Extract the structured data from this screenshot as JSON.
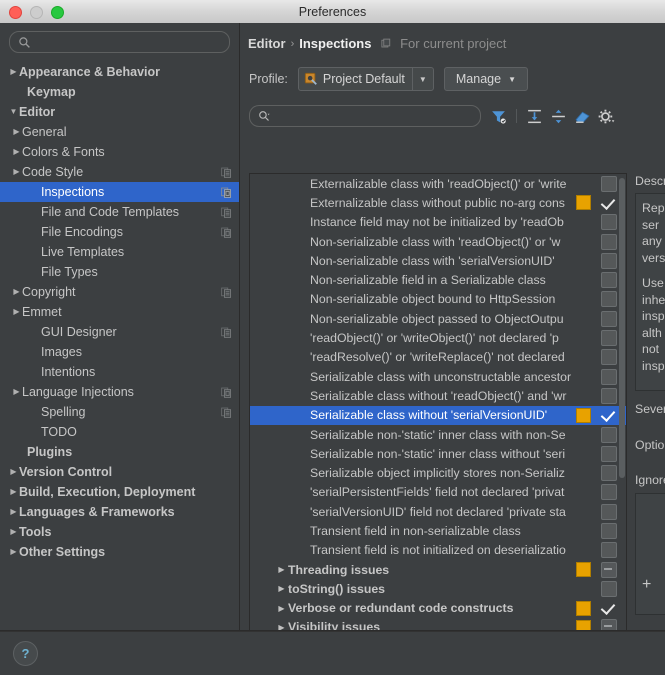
{
  "window": {
    "title": "Preferences",
    "traffic_lights": [
      "close-red",
      "minimize-disabled",
      "zoom-green"
    ]
  },
  "sidebar": {
    "search": {
      "value": "",
      "placeholder": ""
    },
    "items": [
      {
        "label": "Appearance & Behavior",
        "level": 0,
        "arrow": "▶",
        "bold": true,
        "icon": ""
      },
      {
        "label": "Keymap",
        "level": 0,
        "arrow": "",
        "bold": true,
        "icon": ""
      },
      {
        "label": "Editor",
        "level": 0,
        "arrow": "▼",
        "bold": true,
        "icon": ""
      },
      {
        "label": "General",
        "level": 1,
        "arrow": "▶",
        "bold": false,
        "icon": ""
      },
      {
        "label": "Colors & Fonts",
        "level": 1,
        "arrow": "▶",
        "bold": false,
        "icon": ""
      },
      {
        "label": "Code Style",
        "level": 1,
        "arrow": "▶",
        "bold": false,
        "icon": "copy-scope-icon"
      },
      {
        "label": "Inspections",
        "level": 1,
        "arrow": "",
        "bold": false,
        "icon": "project-scope-icon",
        "selected": true
      },
      {
        "label": "File and Code Templates",
        "level": 1,
        "arrow": "",
        "bold": false,
        "icon": "copy-scope-icon"
      },
      {
        "label": "File Encodings",
        "level": 1,
        "arrow": "",
        "bold": false,
        "icon": "project-scope-icon"
      },
      {
        "label": "Live Templates",
        "level": 1,
        "arrow": "",
        "bold": false,
        "icon": ""
      },
      {
        "label": "File Types",
        "level": 1,
        "arrow": "",
        "bold": false,
        "icon": ""
      },
      {
        "label": "Copyright",
        "level": 1,
        "arrow": "▶",
        "bold": false,
        "icon": "copy-scope-icon"
      },
      {
        "label": "Emmet",
        "level": 1,
        "arrow": "▶",
        "bold": false,
        "icon": ""
      },
      {
        "label": "GUI Designer",
        "level": 1,
        "arrow": "",
        "bold": false,
        "icon": "copy-scope-icon"
      },
      {
        "label": "Images",
        "level": 1,
        "arrow": "",
        "bold": false,
        "icon": ""
      },
      {
        "label": "Intentions",
        "level": 1,
        "arrow": "",
        "bold": false,
        "icon": ""
      },
      {
        "label": "Language Injections",
        "level": 1,
        "arrow": "▶",
        "bold": false,
        "icon": "project-scope-icon"
      },
      {
        "label": "Spelling",
        "level": 1,
        "arrow": "",
        "bold": false,
        "icon": "copy-scope-icon"
      },
      {
        "label": "TODO",
        "level": 1,
        "arrow": "",
        "bold": false,
        "icon": ""
      },
      {
        "label": "Plugins",
        "level": 0,
        "arrow": "",
        "bold": true,
        "icon": ""
      },
      {
        "label": "Version Control",
        "level": 0,
        "arrow": "▶",
        "bold": true,
        "icon": ""
      },
      {
        "label": "Build, Execution, Deployment",
        "level": 0,
        "arrow": "▶",
        "bold": true,
        "icon": ""
      },
      {
        "label": "Languages & Frameworks",
        "level": 0,
        "arrow": "▶",
        "bold": true,
        "icon": ""
      },
      {
        "label": "Tools",
        "level": 0,
        "arrow": "▶",
        "bold": true,
        "icon": ""
      },
      {
        "label": "Other Settings",
        "level": 0,
        "arrow": "▶",
        "bold": true,
        "icon": ""
      }
    ]
  },
  "main": {
    "breadcrumb": {
      "parent": "Editor",
      "separator": "›",
      "current": "Inspections",
      "scope": "For current project"
    },
    "profile": {
      "label": "Profile:",
      "value": "Project Default",
      "caret": "▼",
      "manage_label": "Manage",
      "manage_caret": "▼"
    },
    "toolbar": {
      "search_value": "",
      "search_placeholder": "",
      "icons": [
        "filter-icon",
        "expand-all-icon",
        "collapse-all-icon",
        "reset-eraser-icon",
        "gear-icon"
      ]
    },
    "list": [
      {
        "label": "Externalizable class with 'readObject()' or 'write",
        "type": "leaf",
        "severity": null,
        "check": "off"
      },
      {
        "label": "Externalizable class without public no-arg cons",
        "type": "leaf",
        "severity": "#e8a200",
        "check": "on"
      },
      {
        "label": "Instance field may not be initialized by 'readOb",
        "type": "leaf",
        "severity": null,
        "check": "off"
      },
      {
        "label": "Non-serializable class with 'readObject()' or 'w",
        "type": "leaf",
        "severity": null,
        "check": "off"
      },
      {
        "label": "Non-serializable class with 'serialVersionUID'",
        "type": "leaf",
        "severity": null,
        "check": "off"
      },
      {
        "label": "Non-serializable field in a Serializable class",
        "type": "leaf",
        "severity": null,
        "check": "off"
      },
      {
        "label": "Non-serializable object bound to HttpSession",
        "type": "leaf",
        "severity": null,
        "check": "off"
      },
      {
        "label": "Non-serializable object passed to ObjectOutpu",
        "type": "leaf",
        "severity": null,
        "check": "off"
      },
      {
        "label": "'readObject()' or 'writeObject()' not declared 'p",
        "type": "leaf",
        "severity": null,
        "check": "off"
      },
      {
        "label": "'readResolve()' or 'writeReplace()' not declared",
        "type": "leaf",
        "severity": null,
        "check": "off"
      },
      {
        "label": "Serializable class with unconstructable ancestor",
        "type": "leaf",
        "severity": null,
        "check": "off"
      },
      {
        "label": "Serializable class without 'readObject()' and 'wr",
        "type": "leaf",
        "severity": null,
        "check": "off"
      },
      {
        "label": "Serializable class without 'serialVersionUID'",
        "type": "leaf",
        "severity": "#e8a200",
        "check": "on",
        "selected": true
      },
      {
        "label": "Serializable non-'static' inner class with non-Se",
        "type": "leaf",
        "severity": null,
        "check": "off"
      },
      {
        "label": "Serializable non-'static' inner class without 'seri",
        "type": "leaf",
        "severity": null,
        "check": "off"
      },
      {
        "label": "Serializable object implicitly stores non-Serializ",
        "type": "leaf",
        "severity": null,
        "check": "off"
      },
      {
        "label": "'serialPersistentFields' field not declared 'privat",
        "type": "leaf",
        "severity": null,
        "check": "off"
      },
      {
        "label": "'serialVersionUID' field not declared 'private sta",
        "type": "leaf",
        "severity": null,
        "check": "off"
      },
      {
        "label": "Transient field in non-serializable class",
        "type": "leaf",
        "severity": null,
        "check": "off"
      },
      {
        "label": "Transient field is not initialized on deserializatio",
        "type": "leaf",
        "severity": null,
        "check": "off"
      },
      {
        "label": "Threading issues",
        "type": "group",
        "arrow": "▶",
        "severity": "#e8a200",
        "check": "dash"
      },
      {
        "label": "toString() issues",
        "type": "group",
        "arrow": "▶",
        "severity": null,
        "check": "off"
      },
      {
        "label": "Verbose or redundant code constructs",
        "type": "group",
        "arrow": "▶",
        "severity": "#e8a200",
        "check": "on"
      },
      {
        "label": "Visibility issues",
        "type": "group",
        "arrow": "▶",
        "severity": "#e8a200",
        "check": "dash"
      }
    ],
    "description": {
      "title": "Description",
      "lines": [
        "Rep",
        "ser",
        "any",
        "vers"
      ],
      "lines2": [
        "Use",
        "inhe",
        "insp",
        "alth",
        "not",
        "insp"
      ],
      "severity_label": "Severity:",
      "options_label": "Options",
      "ignore_label": "Ignore",
      "add_label": "+"
    }
  },
  "bottom": {
    "help_label": "?"
  }
}
